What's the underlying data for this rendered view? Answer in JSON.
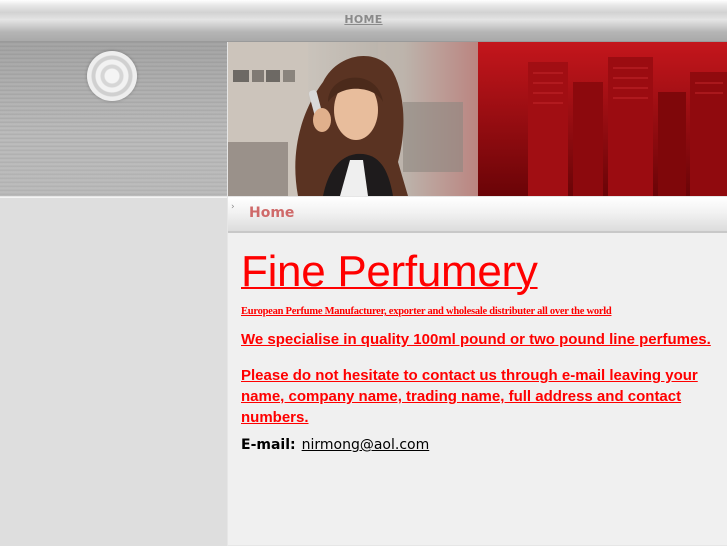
{
  "nav": {
    "home_label": "HOME"
  },
  "breadcrumb": {
    "current": "Home"
  },
  "main": {
    "title": "Fine Perfumery",
    "subtitle": "European Perfume Manufacturer, exporter and wholesale distributer all over the world",
    "paragraph1": "We specialise in quality 100ml pound or two pound line perfumes.",
    "paragraph2": "Please do not hesitate to contact us through e-mail leaving your name, company name, trading name, full address and contact numbers.",
    "email_label": "E-mail:",
    "email_value": "nirmong@aol.com"
  },
  "colors": {
    "accent": "#ff0000",
    "breadcrumb_text": "#cf6a6a",
    "nav_text": "#8a8a8a"
  },
  "icons": {
    "logo": "concentric-circles-logo-icon",
    "breadcrumb": "chevron-right-icon"
  }
}
